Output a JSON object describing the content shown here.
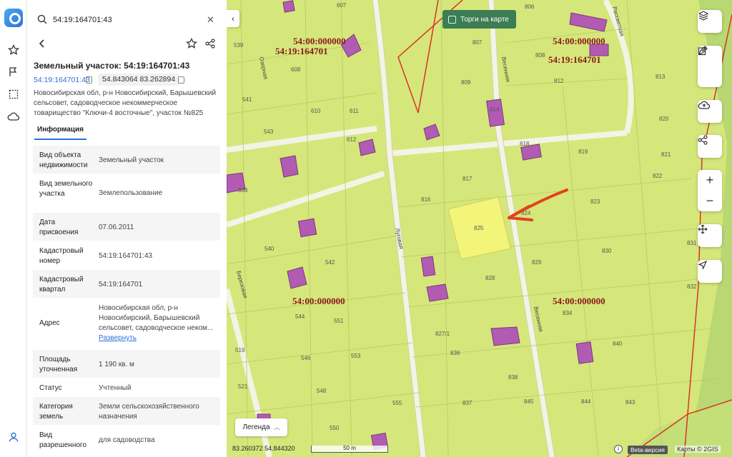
{
  "search": {
    "value": "54:19:164701:43"
  },
  "panel": {
    "title": "Земельный участок: 54:19:164701:43",
    "cad_number": "54:19:164701:43",
    "coords": "54.843064 83.262894",
    "address": "Новосибирская обл, р-н Новосибирский, Барышевский сельсовет, садоводческое некоммерческое товарищество \"Ключи-4 восточные\", участок №825",
    "tab": "Информация"
  },
  "info": {
    "r0": {
      "k": "Вид объекта недвижимости",
      "v": "Земельный участок"
    },
    "r1": {
      "k": "Вид земельного участка",
      "v": "Землепользование"
    },
    "r2": {
      "k": "Дата присвоения",
      "v": "07.06.2011"
    },
    "r3": {
      "k": "Кадастровый номер",
      "v": "54:19:164701:43"
    },
    "r4": {
      "k": "Кадастровый квартал",
      "v": "54:19:164701"
    },
    "r5": {
      "k": "Адрес",
      "v": "Новосибирская обл, р-н Новосибирский, Барышевский сельсовет, садоводческое неком...",
      "link": "Развернуть"
    },
    "r6": {
      "k": "Площадь уточненная",
      "v": "1 190 кв. м"
    },
    "r7": {
      "k": "Статус",
      "v": "Учтенный"
    },
    "r8": {
      "k": "Категория земель",
      "v": "Земли сельскохозяйственного назначения"
    },
    "r9": {
      "k": "Вид разрешенного",
      "v": "для садоводства"
    }
  },
  "map": {
    "torgi_label": "Торги на карте",
    "legend_label": "Легенда",
    "bottom_coords": "83.260372  54.844320",
    "scale_label": "50 m",
    "beta_label": "Beta-версия",
    "copyright": "Карты © 2GIS",
    "labels": {
      "a1": "54:00:000000",
      "a2": "54:19:164701",
      "b1": "54:00:000000",
      "b2": "54:19:164701",
      "c1": "54:00:000000",
      "d1": "54:00:000000",
      "street1": "Весенняя",
      "street2": "Весенняя",
      "street3": "Луговая",
      "street4": "Березовая",
      "street5": "Рассветная",
      "street6": "Озерная"
    },
    "plots": {
      "p607": "607",
      "p806": "806",
      "p807": "807",
      "p808": "808",
      "p539": "539",
      "p608": "608",
      "p809": "809",
      "p812": "812",
      "p813": "813",
      "p541": "541",
      "p610": "610",
      "p611": "611",
      "p814": "814",
      "p820": "820",
      "p543": "543",
      "p612": "612",
      "p818": "818",
      "p819": "819",
      "p821": "821",
      "p817": "817",
      "p822": "822",
      "p538": "538",
      "p816": "816",
      "p823": "823",
      "p824": "824",
      "p825": "825",
      "p540": "540",
      "p829": "829",
      "p830": "830",
      "p831": "831",
      "p542": "542",
      "p828": "828",
      "p832": "832",
      "p544": "544",
      "p551": "551",
      "p834": "834",
      "p827": "827/1",
      "p546": "546",
      "p553": "553",
      "p836": "836",
      "p840": "840",
      "p519": "519",
      "p838": "838",
      "p521": "521",
      "p548": "548",
      "p837": "837",
      "p845": "845",
      "p844": "844",
      "p843": "843",
      "p555": "555",
      "p550": "550"
    }
  },
  "colors": {
    "accent": "#2a73d9",
    "map_bg": "#d5e77a",
    "building": "#b25bb3",
    "highlight": "#f3f57a",
    "boundary": "#d8322a"
  }
}
